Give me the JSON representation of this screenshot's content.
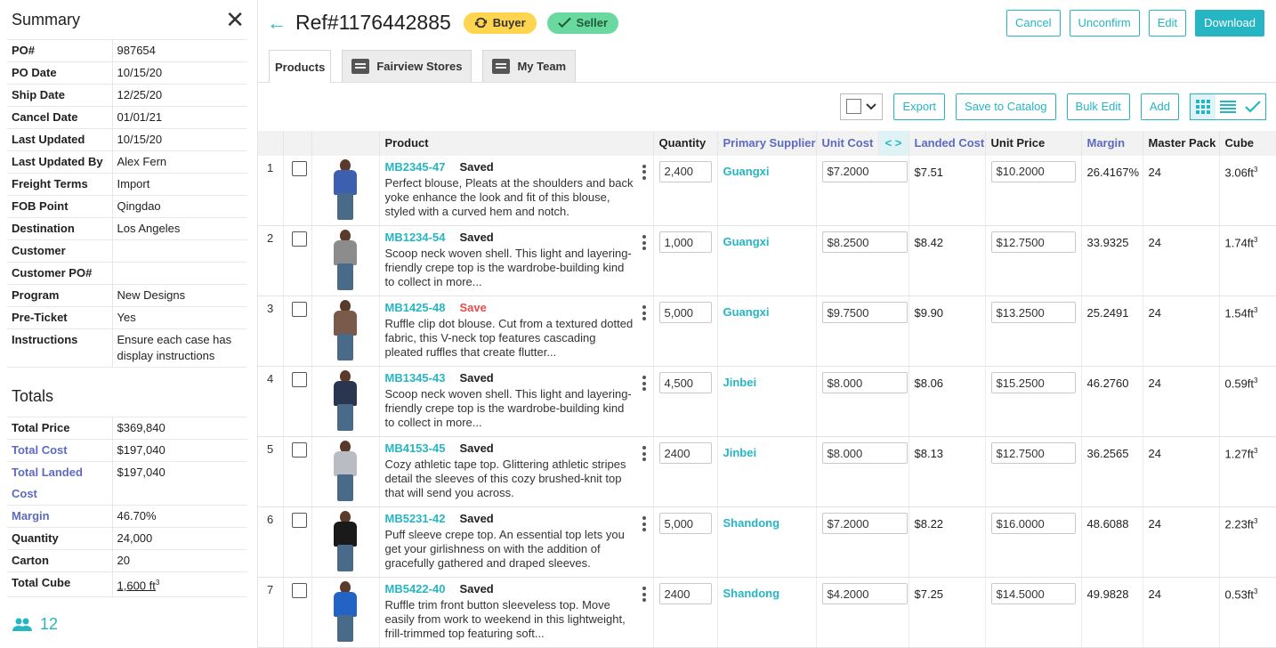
{
  "sidebar": {
    "title": "Summary",
    "summary": [
      {
        "label": "PO#",
        "value": "987654"
      },
      {
        "label": "PO Date",
        "value": "10/15/20"
      },
      {
        "label": "Ship Date",
        "value": "12/25/20"
      },
      {
        "label": "Cancel Date",
        "value": "01/01/21"
      },
      {
        "label": "Last Updated",
        "value": "10/15/20"
      },
      {
        "label": "Last Updated By",
        "value": "Alex Fern"
      },
      {
        "label": "Freight Terms",
        "value": "Import"
      },
      {
        "label": "FOB Point",
        "value": "Qingdao"
      },
      {
        "label": "Destination",
        "value": "Los Angeles"
      },
      {
        "label": "Customer",
        "value": ""
      },
      {
        "label": "Customer PO#",
        "value": ""
      },
      {
        "label": "Program",
        "value": "New Designs"
      },
      {
        "label": "Pre-Ticket",
        "value": "Yes"
      },
      {
        "label": "Instructions",
        "value": "Ensure each case has display instructions"
      }
    ],
    "totals_title": "Totals",
    "totals": [
      {
        "label": "Total Price",
        "value": "$369,840",
        "link": false
      },
      {
        "label": "Total Cost",
        "value": "$197,040",
        "link": true
      },
      {
        "label": "Total Landed Cost",
        "value": "$197,040",
        "link": true
      },
      {
        "label": "Margin",
        "value": "46.70%",
        "link": true
      },
      {
        "label": "Quantity",
        "value": "24,000",
        "link": false
      },
      {
        "label": "Carton",
        "value": "20",
        "link": false
      }
    ],
    "total_cube": {
      "label": "Total Cube",
      "value": "1,600 ft",
      "sup": "3"
    },
    "team_count": "12"
  },
  "header": {
    "ref": "Ref#1176442885",
    "badges": {
      "buyer": "Buyer",
      "seller": "Seller"
    },
    "actions": {
      "cancel": "Cancel",
      "unconfirm": "Unconfirm",
      "edit": "Edit",
      "download": "Download"
    }
  },
  "tabs": {
    "products": "Products",
    "fairview": "Fairview Stores",
    "team": "My Team"
  },
  "toolbar": {
    "export": "Export",
    "save_catalog": "Save to Catalog",
    "bulk_edit": "Bulk Edit",
    "add": "Add"
  },
  "columns": {
    "product": "Product",
    "quantity": "Quantity",
    "supplier": "Primary Supplier",
    "unit_cost": "Unit Cost",
    "landed": "Landed Cost",
    "unit_price": "Unit Price",
    "margin": "Margin",
    "pack": "Master Pack",
    "cube": "Cube"
  },
  "rows": [
    {
      "n": "1",
      "sku": "MB2345-47",
      "status": "Saved",
      "status_red": false,
      "desc": "Perfect blouse, Pleats at the shoulders and back yoke enhance the look and fit of this blouse, styled with a curved hem and notch.",
      "qty": "2,400",
      "supplier": "Guangxi",
      "unit_cost": "$7.2000",
      "landed": "$7.51",
      "unit_price": "$10.2000",
      "margin": "26.4167%",
      "pack": "24",
      "cube": "3.06ft",
      "top_color": "#3d5fb0"
    },
    {
      "n": "2",
      "sku": "MB1234-54",
      "status": "Saved",
      "status_red": false,
      "desc": "Scoop neck woven shell. This light and layering-friendly crepe top is the wardrobe-building kind to collect in more...",
      "qty": "1,000",
      "supplier": "Guangxi",
      "unit_cost": "$8.2500",
      "landed": "$8.42",
      "unit_price": "$12.7500",
      "margin": "33.9325",
      "pack": "24",
      "cube": "1.74ft",
      "top_color": "#8c8c8c"
    },
    {
      "n": "3",
      "sku": "MB1425-48",
      "status": "Save",
      "status_red": true,
      "desc": "Ruffle clip dot blouse. Cut from a textured dotted fabric, this V-neck top features cascading pleated ruffles that create flutter...",
      "qty": "5,000",
      "supplier": "Guangxi",
      "unit_cost": "$9.7500",
      "landed": "$9.90",
      "unit_price": "$13.2500",
      "margin": "25.2491",
      "pack": "24",
      "cube": "1.54ft",
      "top_color": "#7a5a4a"
    },
    {
      "n": "4",
      "sku": "MB1345-43",
      "status": "Saved",
      "status_red": false,
      "desc": "Scoop neck woven shell. This light and layering-friendly crepe top is the wardrobe-building kind to collect in more...",
      "qty": "4,500",
      "supplier": "Jinbei",
      "unit_cost": "$8.000",
      "landed": "$8.06",
      "unit_price": "$15.2500",
      "margin": "46.2760",
      "pack": "24",
      "cube": "0.59ft",
      "top_color": "#2a3550"
    },
    {
      "n": "5",
      "sku": "MB4153-45",
      "status": "Saved",
      "status_red": false,
      "desc": "Cozy athletic tape top. Glittering athletic stripes detail the sleeves of this cozy brushed-knit top that will send you across.",
      "qty": "2400",
      "supplier": "Jinbei",
      "unit_cost": "$8.000",
      "landed": "$8.13",
      "unit_price": "$12.7500",
      "margin": "36.2565",
      "pack": "24",
      "cube": "1.27ft",
      "top_color": "#b9bcc2"
    },
    {
      "n": "6",
      "sku": "MB5231-42",
      "status": "Saved",
      "status_red": false,
      "desc": "Puff sleeve crepe top. An essential top lets you get your girlishness on with the addition of gracefully gathered and draped sleeves.",
      "qty": "5,000",
      "supplier": "Shandong",
      "unit_cost": "$7.2000",
      "landed": "$8.22",
      "unit_price": "$16.0000",
      "margin": "48.6088",
      "pack": "24",
      "cube": "2.23ft",
      "top_color": "#1a1a1a"
    },
    {
      "n": "7",
      "sku": "MB5422-40",
      "status": "Saved",
      "status_red": false,
      "desc": "Ruffle trim front button sleeveless top. Move easily from work to weekend in this lightweight, frill-trimmed top featuring soft...",
      "qty": "2400",
      "supplier": "Shandong",
      "unit_cost": "$4.2000",
      "landed": "$7.25",
      "unit_price": "$14.5000",
      "margin": "49.9828",
      "pack": "24",
      "cube": "0.53ft",
      "top_color": "#2463c6"
    }
  ],
  "cube_sup": "3",
  "colors": {
    "accent": "#26b5c3",
    "link_purple": "#5c6bc0",
    "buyer": "#ffd54f",
    "seller": "#69d99f",
    "error": "#e84a4a"
  }
}
